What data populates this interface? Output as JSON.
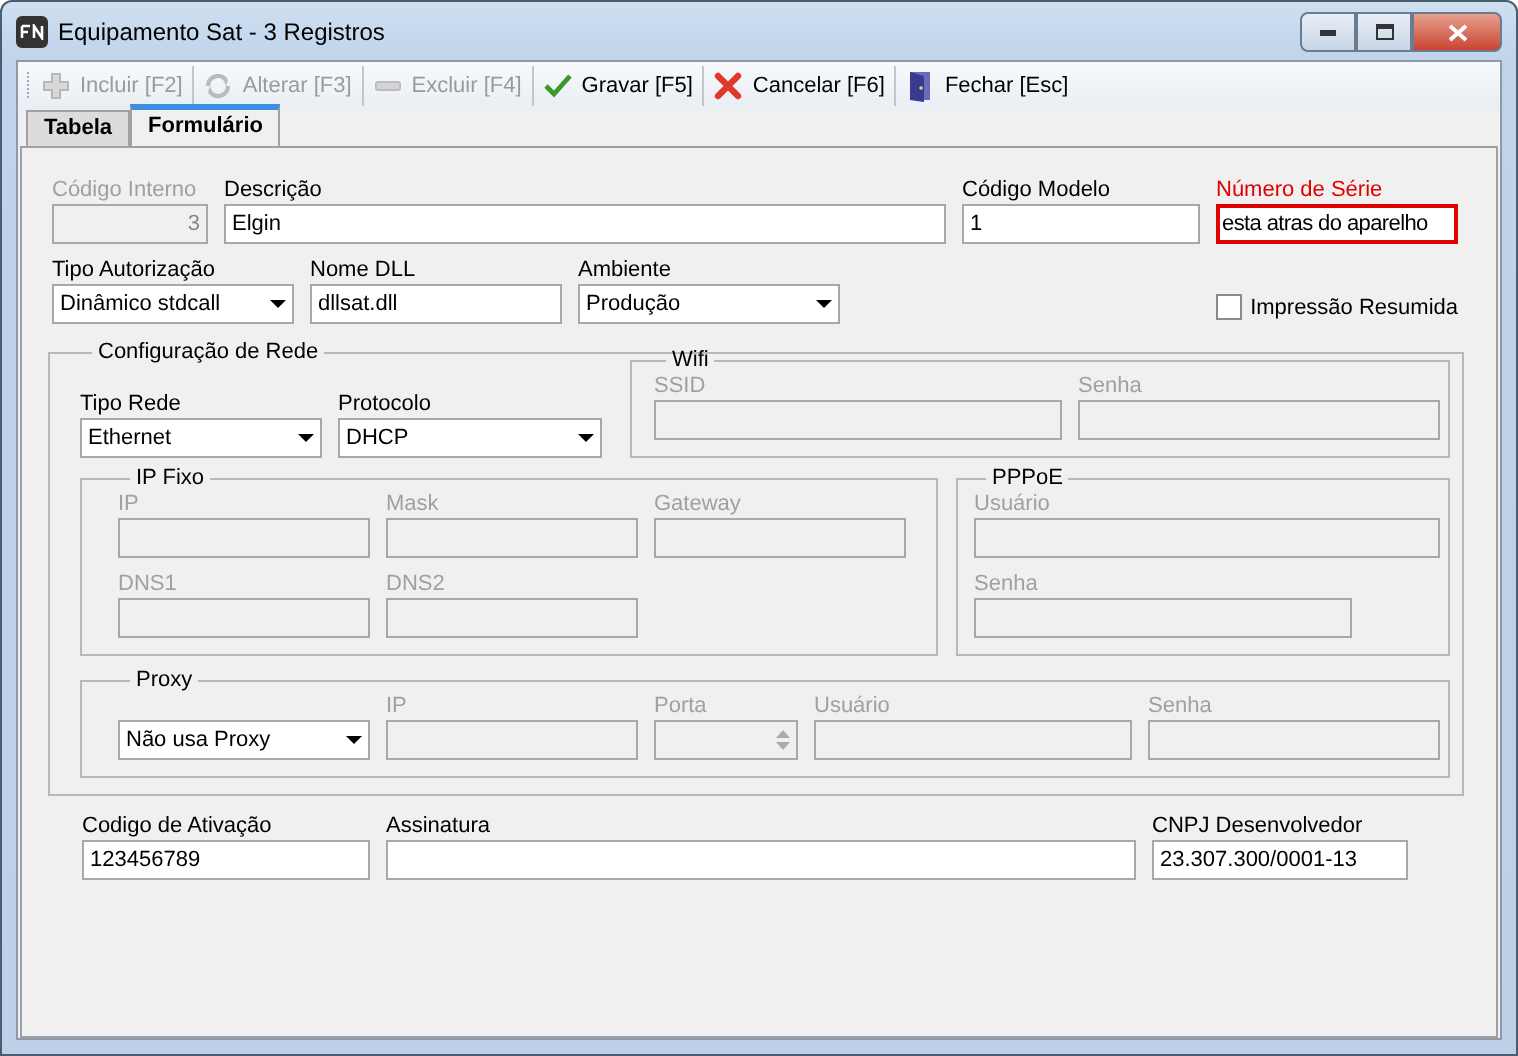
{
  "window": {
    "title": "Equipamento Sat - 3 Registros"
  },
  "toolbar": [
    {
      "kind": "add",
      "label": "Incluir [F2]",
      "disabled": true
    },
    {
      "kind": "edit",
      "label": "Alterar [F3]",
      "disabled": true
    },
    {
      "kind": "remove",
      "label": "Excluir [F4]",
      "disabled": true
    },
    {
      "kind": "save",
      "label": "Gravar [F5]",
      "disabled": false
    },
    {
      "kind": "cancel",
      "label": "Cancelar [F6]",
      "disabled": false
    },
    {
      "kind": "close",
      "label": "Fechar [Esc]",
      "disabled": false
    }
  ],
  "tabs": [
    {
      "label": "Tabela",
      "selected": false
    },
    {
      "label": "Formulário",
      "selected": true
    }
  ],
  "form": {
    "row_1": [
      {
        "kind": "number",
        "label": "Código Interno",
        "value": "3",
        "disabled": true,
        "required": false
      },
      {
        "kind": "text",
        "label": "Descrição",
        "value": "Elgin",
        "disabled": false,
        "required": false
      },
      {
        "kind": "text",
        "label": "Código Modelo",
        "value": "1",
        "disabled": false,
        "required": false
      },
      {
        "kind": "text",
        "label": "Número de Série",
        "value": "esta atras do aparelho",
        "disabled": false,
        "required": true
      }
    ],
    "row_2": [
      {
        "kind": "combo",
        "label": "Tipo Autorização",
        "value": "Dinâmico stdcall",
        "disabled": false,
        "required": false
      },
      {
        "kind": "text",
        "label": "Nome DLL",
        "value": "dllsat.dll",
        "disabled": false,
        "required": false
      },
      {
        "kind": "combo",
        "label": "Ambiente",
        "value": "Produção",
        "disabled": false,
        "required": false
      }
    ],
    "impressao_resumida": {
      "label": "Impressão Resumida",
      "checked": false
    },
    "rede": {
      "title": "Configuração de Rede",
      "fields": [
        {
          "kind": "combo",
          "label": "Tipo Rede",
          "value": "Ethernet",
          "disabled": false,
          "required": false
        },
        {
          "kind": "combo",
          "label": "Protocolo",
          "value": "DHCP",
          "disabled": false,
          "required": false
        }
      ],
      "wifi": {
        "title": "Wifi",
        "fields": [
          {
            "kind": "text",
            "label": "SSID",
            "disabled": true,
            "required": false
          },
          {
            "kind": "text",
            "label": "Senha",
            "disabled": true,
            "required": false
          }
        ]
      },
      "ip_fixo": {
        "title": "IP Fixo",
        "fields": [
          {
            "kind": "text",
            "label": "IP",
            "disabled": true,
            "required": false
          },
          {
            "kind": "text",
            "label": "Mask",
            "disabled": true,
            "required": false
          },
          {
            "kind": "text",
            "label": "Gateway",
            "disabled": true,
            "required": false
          },
          {
            "kind": "text",
            "label": "DNS1",
            "disabled": true,
            "required": false
          },
          {
            "kind": "text",
            "label": "DNS2",
            "disabled": true,
            "required": false
          }
        ]
      },
      "pppoe": {
        "title": "PPPoE",
        "fields": [
          {
            "kind": "text",
            "label": "Usuário",
            "disabled": true,
            "required": false
          },
          {
            "kind": "text",
            "label": "Senha",
            "disabled": true,
            "required": false
          }
        ]
      },
      "proxy": {
        "title": "Proxy",
        "fields": [
          {
            "kind": "combo",
            "value": "Não usa Proxy",
            "disabled": false,
            "required": false
          },
          {
            "kind": "text",
            "label": "IP",
            "disabled": true,
            "required": false
          },
          {
            "kind": "spin",
            "label": "Porta",
            "disabled": true,
            "required": false
          },
          {
            "kind": "text",
            "label": "Usuário",
            "disabled": true,
            "required": false
          },
          {
            "kind": "text",
            "label": "Senha",
            "disabled": true,
            "required": false
          }
        ]
      }
    },
    "row_3": [
      {
        "kind": "text",
        "label": "Codigo de Ativação",
        "value": "123456789",
        "disabled": false,
        "required": false
      },
      {
        "kind": "text",
        "label": "Assinatura",
        "disabled": false,
        "required": false
      },
      {
        "kind": "text",
        "label": "CNPJ Desenvolvedor",
        "value": "23.307.300/0001-13",
        "disabled": false,
        "required": false
      }
    ]
  }
}
